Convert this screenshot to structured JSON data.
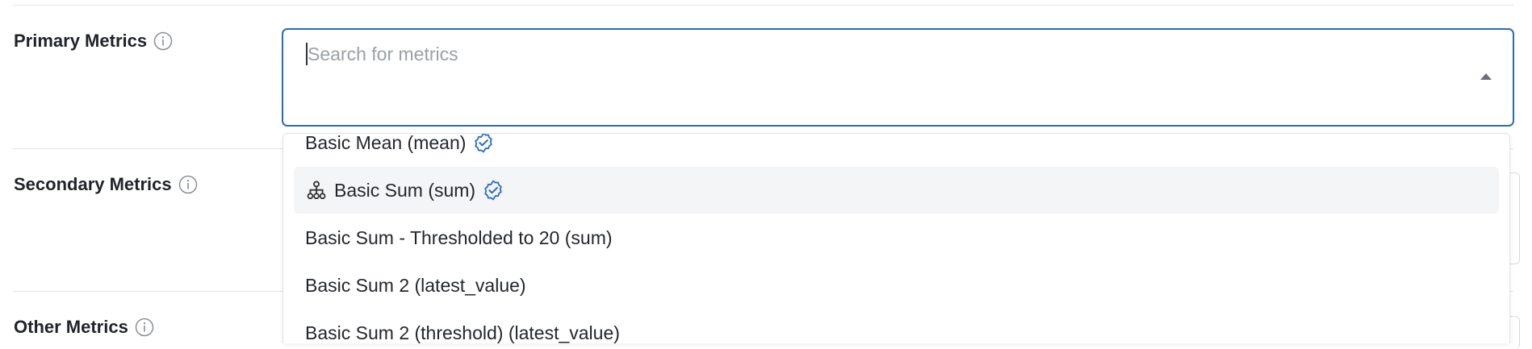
{
  "rows": [
    {
      "label": "Primary Metrics",
      "icon": "info-icon"
    },
    {
      "label": "Secondary Metrics",
      "icon": "info-icon"
    },
    {
      "label": "Other Metrics",
      "icon": "info-icon"
    }
  ],
  "primary_search": {
    "placeholder": "Search for metrics",
    "value": "",
    "open": true
  },
  "dropdown": {
    "options": [
      {
        "label": "Basic Mean (mean)",
        "verified": true,
        "leading_icon": null,
        "highlighted": false
      },
      {
        "label": "Basic Sum (sum)",
        "verified": true,
        "leading_icon": "hierarchy-icon",
        "highlighted": true
      },
      {
        "label": "Basic Sum - Thresholded to 20 (sum)",
        "verified": false,
        "leading_icon": null,
        "highlighted": false
      },
      {
        "label": "Basic Sum 2 (latest_value)",
        "verified": false,
        "leading_icon": null,
        "highlighted": false
      },
      {
        "label": "Basic Sum 2 (threshold) (latest_value)",
        "verified": false,
        "leading_icon": null,
        "highlighted": false
      }
    ]
  },
  "colors": {
    "accent": "#2b6cb0",
    "verified": "#2f6fc8",
    "highlight_bg": "#f4f5f6",
    "divider": "#e3e5e8"
  }
}
